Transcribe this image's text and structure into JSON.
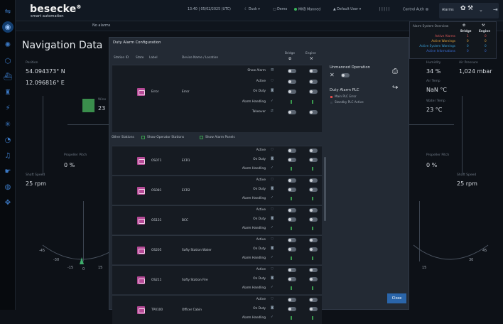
{
  "brand": {
    "name": "besecke",
    "tagline": "smart automation"
  },
  "topbar": {
    "datetime": "13:40 | 05/02/2025 (UTC)",
    "theme": "Dusk",
    "connection": "Demo",
    "mode": "MKB Manned",
    "user": "Default User",
    "signal": "| | | | |",
    "control": "Control Auth",
    "alarms_label": "Alarms"
  },
  "subbar": {
    "message": "No alarms"
  },
  "nav": {
    "title": "Navigation Data",
    "position_label": "Position",
    "lat": "54.094373° N",
    "lon": "12.096816° E",
    "propeller_label": "Propeller Pitch",
    "propeller_val": "0 %",
    "shaft_label": "Shaft Speed",
    "shaft_val": "25 rpm",
    "left_partial_label": "Wine",
    "left_partial_val": "23"
  },
  "right_data": {
    "humidity_label": "Humidity",
    "humidity": "34 %",
    "air_pressure_label": "Air Pressure",
    "air_pressure": "1,024 mbar",
    "air_temp_label": "Air Temp",
    "air_temp": "NaN °C",
    "water_temp_label": "Water Temp",
    "water_temp": "23 °C",
    "propeller_label": "Propeller Pitch",
    "propeller_val": "0 %",
    "shaft_label": "Shaft Speed",
    "shaft_val": "25 rpm"
  },
  "dial_left": {
    "ticks": [
      "-45",
      "-30",
      "-15",
      "0",
      "15"
    ]
  },
  "dial_right": {
    "ticks": [
      "15",
      "30",
      "45"
    ]
  },
  "alarm_overview": {
    "title": "Alarm System Overview",
    "col_bridge": "Bridge",
    "col_engine": "Engine",
    "rows": [
      {
        "label": "Active Alarms",
        "bridge": "1",
        "engine": "0",
        "color": "#e05858"
      },
      {
        "label": "Active Warnings",
        "bridge": "0",
        "engine": "0",
        "color": "#e3a43a"
      },
      {
        "label": "Active System Warnings",
        "bridge": "0",
        "engine": "0",
        "color": "#3aa0d8"
      },
      {
        "label": "Active Informations",
        "bridge": "0",
        "engine": "0",
        "color": "#3a6ed8"
      }
    ]
  },
  "modal": {
    "title": "Duty Alarm Configuration",
    "headers": {
      "station_id": "Station ID",
      "state": "State",
      "label": "Label",
      "device": "Device Name / Location",
      "bridge": "Bridge",
      "engine": "Engine"
    },
    "controls": [
      "Show Alarm",
      "Active",
      "On Duty",
      "Alarm Handling",
      "Takeover"
    ],
    "top_station": {
      "id": "Error",
      "label": "Error"
    },
    "other_label": "Other Stations",
    "show_operator": "Show Operator Stations",
    "show_alarm_panels": "Show Alarm Panels",
    "station_controls": [
      "Active",
      "On Duty",
      "Alarm Handling"
    ],
    "stations": [
      {
        "id": "OS071",
        "name": "ECR1"
      },
      {
        "id": "OS081",
        "name": "ECR2"
      },
      {
        "id": "OS131",
        "name": "BCC"
      },
      {
        "id": "OS205",
        "name": "Safty Station Water"
      },
      {
        "id": "OS211",
        "name": "Safty Station Fire"
      },
      {
        "id": "TP0100",
        "name": "Officer Cabin"
      }
    ],
    "last_row": "Active",
    "unmanned_title": "Unmanned Operation",
    "duty_plc_title": "Duty Alarm PLC",
    "plc_main": "Main PLC Error",
    "plc_standby": "Standby PLC Active",
    "close": "Close"
  }
}
